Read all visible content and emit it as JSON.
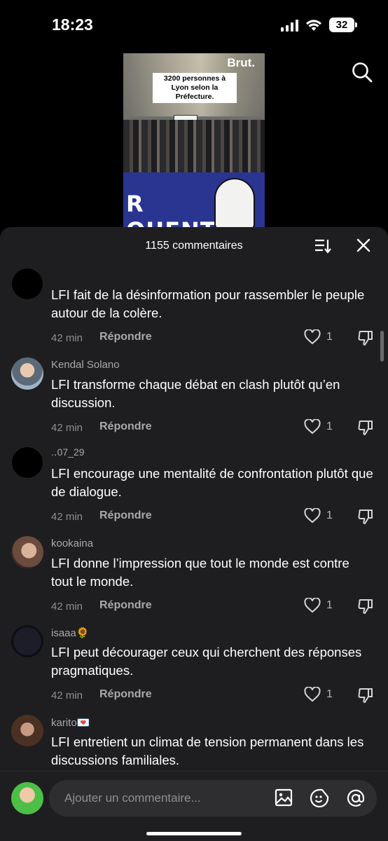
{
  "status": {
    "time": "18:23",
    "battery": "32"
  },
  "video": {
    "brand": "Brut.",
    "caption": "3200 personnes à Lyon selon la Préfecture.",
    "banner_text": "R QUENTIN"
  },
  "sheet": {
    "title": "1155 commentaires"
  },
  "comments": [
    {
      "user": "",
      "text": "LFI fait de la désinformation pour rassembler le peuple autour de la colère.",
      "time": "42 min",
      "reply": "Répondre",
      "likes": "1"
    },
    {
      "user": "Kendal Solano",
      "text": "LFI transforme chaque débat en clash plutôt qu’en discussion.",
      "time": "42 min",
      "reply": "Répondre",
      "likes": "1"
    },
    {
      "user": ".․07_29",
      "text": "LFI encourage une mentalité de confrontation plutôt que de dialogue.",
      "time": "42 min",
      "reply": "Répondre",
      "likes": "1"
    },
    {
      "user": "kookaina",
      "text": "LFI donne l’impression que tout le monde est contre tout le monde.",
      "time": "42 min",
      "reply": "Répondre",
      "likes": "1"
    },
    {
      "user": "isaaa🌻",
      "text": "LFI peut décourager ceux qui cherchent des réponses pragmatiques.",
      "time": "42 min",
      "reply": "Répondre",
      "likes": "1"
    },
    {
      "user": "karito💌",
      "text": "LFI entretient un climat de tension permanent dans les discussions familiales.",
      "time": "",
      "reply": "",
      "likes": ""
    }
  ],
  "input": {
    "placeholder": "Ajouter un commentaire..."
  },
  "colors": {
    "sheet_bg": "#1e1e20",
    "input_bg": "#2e2e31",
    "text_secondary": "#a9a9ad"
  }
}
